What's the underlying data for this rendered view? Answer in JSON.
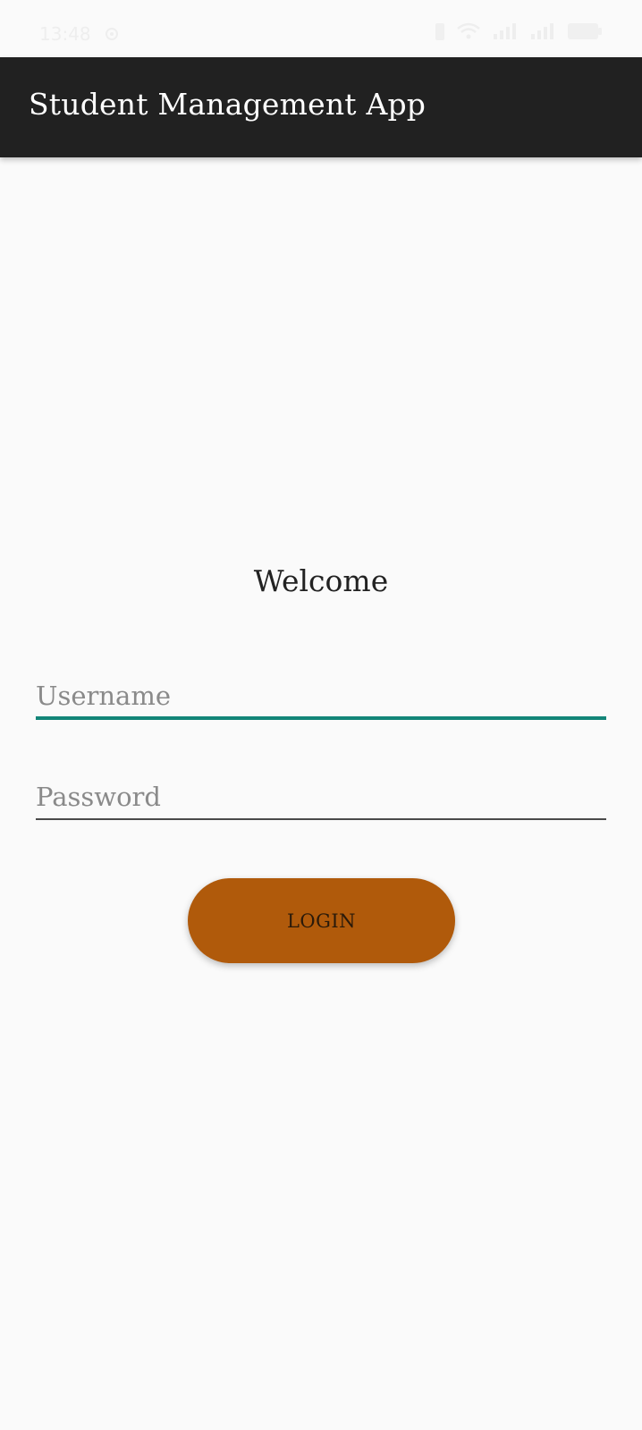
{
  "status_bar": {
    "time": "13:48",
    "icons": [
      "settings-icon",
      "battery-saver-icon",
      "wifi-icon",
      "signal-icon",
      "signal-icon",
      "battery-icon"
    ]
  },
  "app_bar": {
    "title": "Student Management App",
    "background_color": "#212121"
  },
  "login_form": {
    "welcome_text": "Welcome",
    "username": {
      "value": "",
      "placeholder": "Username",
      "underline_color": "#138578"
    },
    "password": {
      "value": "",
      "placeholder": "Password"
    },
    "login_button": {
      "label": "LOGIN",
      "color": "#b05a0b"
    }
  }
}
